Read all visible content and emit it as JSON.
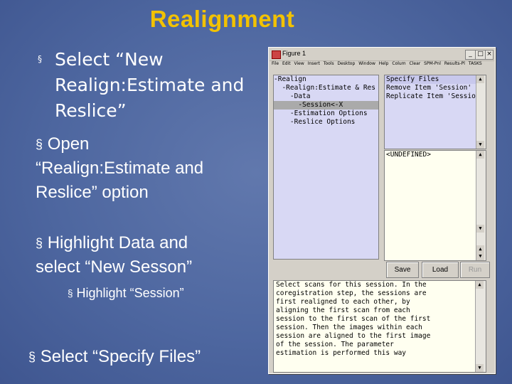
{
  "slide": {
    "title": "Realignment",
    "bullets": {
      "b1_line1": "Select “New",
      "b1_line2": "Realign:Estimate and",
      "b1_line3": "Reslice”",
      "b2_line1": "Open",
      "b2_line2": "“Realign:Estimate and",
      "b2_line3": "Reslice” option",
      "b3_line1": "Highlight Data and",
      "b3_line2": "select “New Sesson”",
      "b4": "Highlight “Session”",
      "b5": "Select “Specify Files”"
    },
    "bullet_glyph": "§"
  },
  "window": {
    "title": "Figure 1",
    "controls": {
      "minimize": "_",
      "maximize": "□",
      "close": "×"
    },
    "menu": [
      "File",
      "Edit",
      "View",
      "Insert",
      "Tools",
      "Desktop",
      "Window",
      "Help",
      "Colum",
      "Clear",
      "SPM-Pnl",
      "Results-Pl",
      "TASKS"
    ],
    "tree": [
      "-Realign",
      "  -Realign:Estimate & Res ice",
      "    -Data",
      "      -Session<-X",
      "    -Estimation Options",
      "    -Reslice Options"
    ],
    "tree_selected_index": 3,
    "options": [
      "Specify Files",
      "Remove Item 'Session'",
      "Replicate Item 'Session'"
    ],
    "value_text": "<UNDEFINED>",
    "buttons": {
      "save": "Save",
      "load": "Load",
      "run": "Run"
    },
    "help_lines": [
      "Select scans for this session. In the",
      "coregistration step, the sessions are",
      "first realigned to each other, by",
      "aligning the first scan from each",
      "session to the first scan of the first",
      "session. Then the images within each",
      "session are aligned to the first image",
      "of the session. The parameter",
      "estimation is performed this way"
    ]
  },
  "colors": {
    "title": "#f2c200",
    "background": "#4e67a0",
    "text": "#ffffff"
  },
  "icons": [
    "bullet-square-icon",
    "matlab-figure-icon",
    "scroll-up-arrow-icon",
    "scroll-down-arrow-icon"
  ]
}
